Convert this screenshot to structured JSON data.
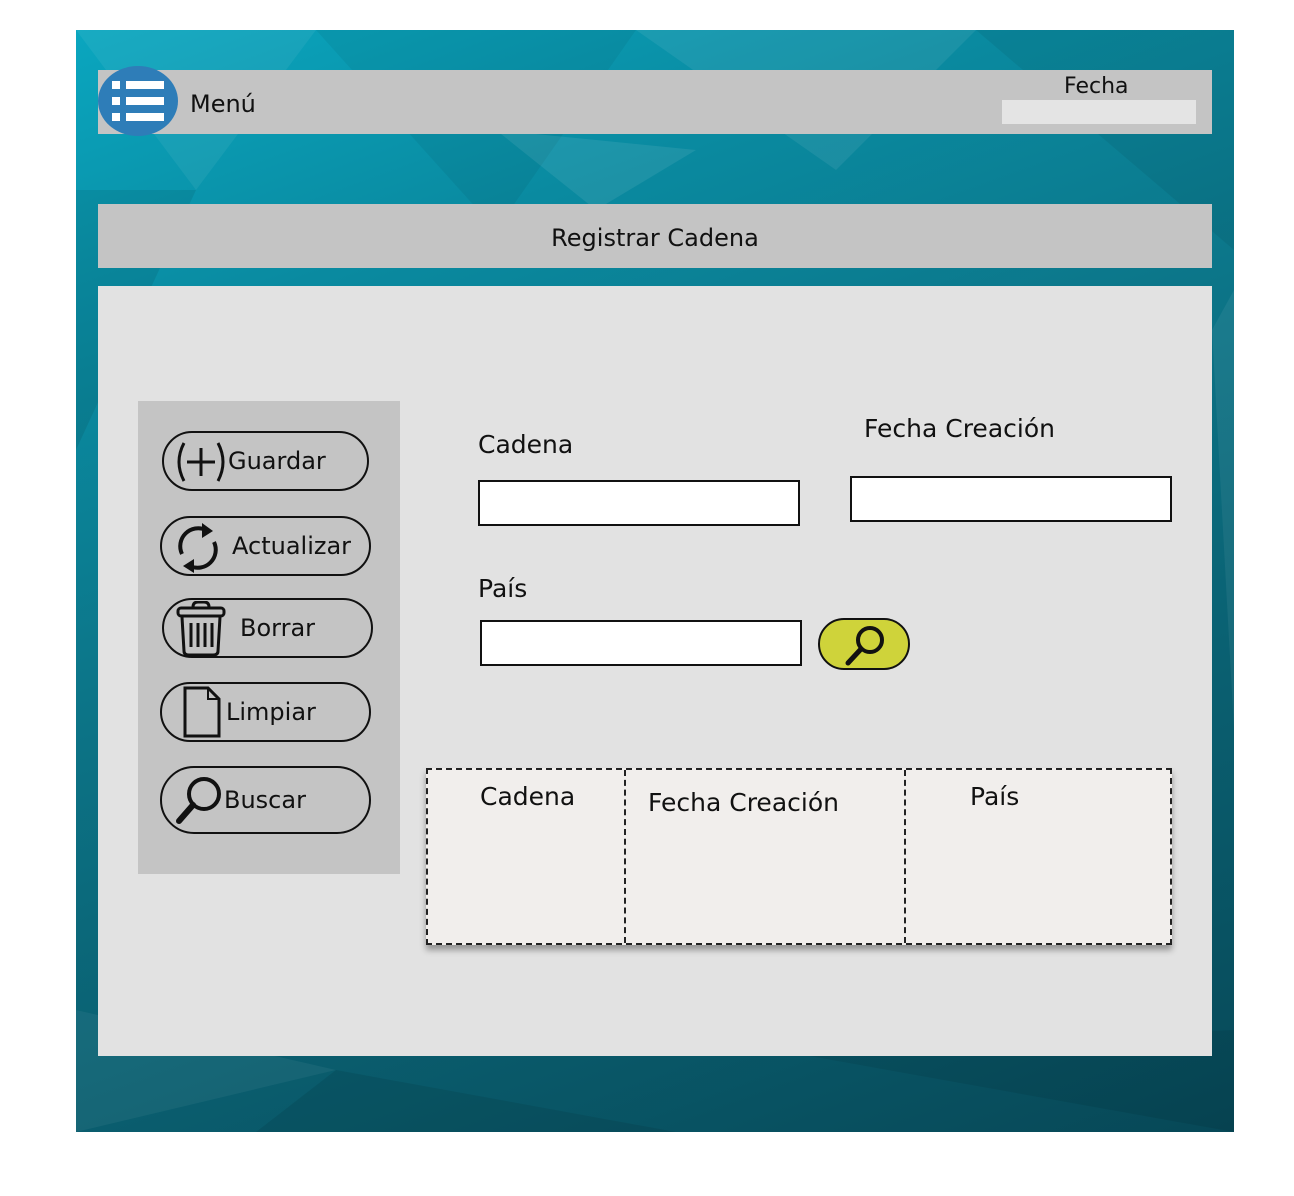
{
  "header": {
    "menu_label": "Menú",
    "fecha_label": "Fecha",
    "fecha_value": ""
  },
  "page_title": "Registrar Cadena",
  "actions": [
    {
      "label": "Guardar",
      "icon": "plus-circle-icon"
    },
    {
      "label": "Actualizar",
      "icon": "refresh-icon"
    },
    {
      "label": "Borrar",
      "icon": "trash-icon"
    },
    {
      "label": "Limpiar",
      "icon": "document-icon"
    },
    {
      "label": "Buscar",
      "icon": "search-icon"
    }
  ],
  "form": {
    "cadena_label": "Cadena",
    "cadena_value": "",
    "fecha_creacion_label": "Fecha Creación",
    "fecha_creacion_value": "",
    "pais_label": "País",
    "pais_value": "",
    "pais_search_icon": "search-icon"
  },
  "table": {
    "columns": [
      "Cadena",
      "Fecha Creación",
      "País"
    ],
    "rows": []
  },
  "colors": {
    "menu_button": "#2e7db8",
    "search_button": "#cfd33a",
    "bar_gray": "#c4c4c4",
    "panel_gray": "#e2e2e2",
    "background_teal": "#0a8aa0"
  }
}
